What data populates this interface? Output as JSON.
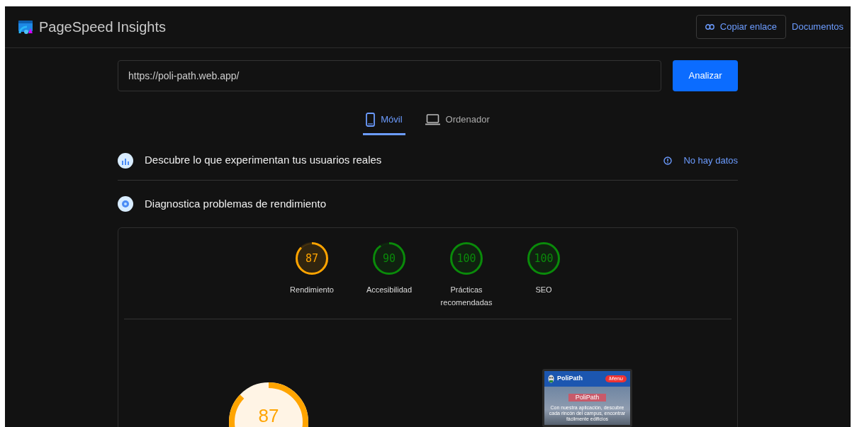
{
  "header": {
    "title": "PageSpeed Insights",
    "copy_link": "Copiar enlace",
    "docs_link": "Documentos"
  },
  "url_field": {
    "value": "https://poli-path.web.app/"
  },
  "analyze_button": "Analizar",
  "device_tabs": [
    {
      "label": "Móvil",
      "kind": "phone",
      "selected": true
    },
    {
      "label": "Ordenador",
      "kind": "laptop",
      "selected": false
    }
  ],
  "field_data": {
    "title": "Descubre lo que experimentan tus usuarios reales",
    "status": "No hay datos"
  },
  "lab_data": {
    "title": "Diagnostica problemas de rendimiento"
  },
  "gauges": [
    {
      "score": "87",
      "label": "Rendimiento",
      "color": "#ffa400"
    },
    {
      "score": "90",
      "label": "Accesibilidad",
      "color": "#0a8a0a"
    },
    {
      "score": "100",
      "label": "Prácticas recomendadas",
      "color": "#0a8a0a"
    },
    {
      "score": "100",
      "label": "SEO",
      "color": "#0a8a0a"
    }
  ],
  "main_gauge": {
    "score": "87",
    "color": "#ffa400"
  },
  "preview": {
    "brand": "PoliPath",
    "menu": "Menu",
    "heading": "PoliPath",
    "text": "Con nuestra aplicación, descubre cada rincón del campus, encontrar fácilmente edificios"
  }
}
